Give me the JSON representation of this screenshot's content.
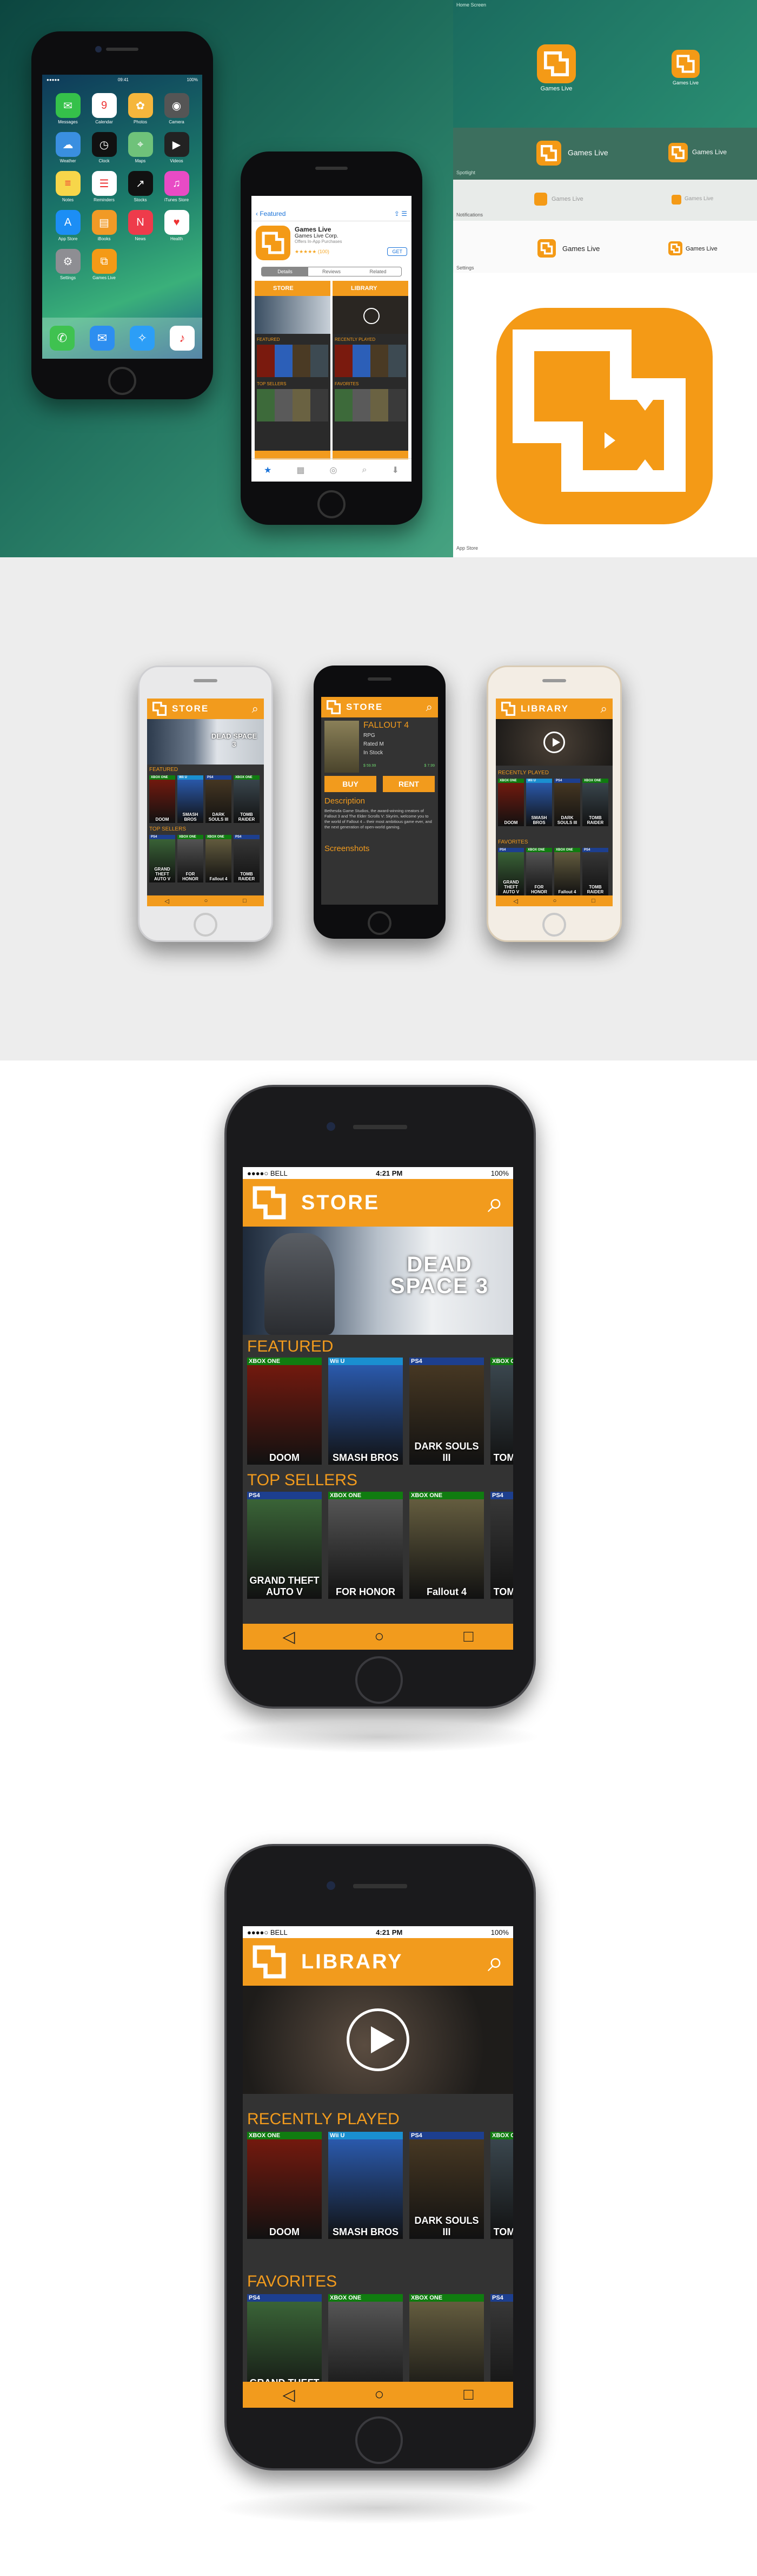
{
  "colors": {
    "accent": "#f29b1d",
    "appBg": "#333333",
    "iconOrange": "#f49a16"
  },
  "home": {
    "time": "09:41",
    "apps": [
      {
        "label": "Messages",
        "color": "#35c14a",
        "icon": "speech-bubble-icon"
      },
      {
        "label": "Calendar",
        "color": "#ffffff",
        "icon": "calendar-icon"
      },
      {
        "label": "Photos",
        "color": "#f5b63c",
        "icon": "photos-icon"
      },
      {
        "label": "Camera",
        "color": "#555555",
        "icon": "camera-icon"
      },
      {
        "label": "Weather",
        "color": "#3a8fe0",
        "icon": "weather-icon"
      },
      {
        "label": "Clock",
        "color": "#111111",
        "icon": "clock-icon"
      },
      {
        "label": "Maps",
        "color": "#6fc27a",
        "icon": "map-icon"
      },
      {
        "label": "Videos",
        "color": "#222222",
        "icon": "video-icon"
      },
      {
        "label": "Notes",
        "color": "#f7d64a",
        "icon": "notes-icon"
      },
      {
        "label": "Reminders",
        "color": "#ffffff",
        "icon": "reminders-icon"
      },
      {
        "label": "Stocks",
        "color": "#111111",
        "icon": "stocks-icon"
      },
      {
        "label": "iTunes Store",
        "color": "#e84bc5",
        "icon": "itunes-icon"
      },
      {
        "label": "App Store",
        "color": "#1c8ef5",
        "icon": "app-store-icon"
      },
      {
        "label": "iBooks",
        "color": "#f19a26",
        "icon": "books-icon"
      },
      {
        "label": "News",
        "color": "#ee3b4b",
        "icon": "news-icon"
      },
      {
        "label": "Health",
        "color": "#ffffff",
        "icon": "health-icon"
      },
      {
        "label": "Settings",
        "color": "#8e8e93",
        "icon": "settings-icon"
      },
      {
        "label": "Games Live",
        "color": "#f49a16",
        "icon": "games-live-icon"
      }
    ],
    "dock": [
      {
        "label": "Phone",
        "color": "#3fc250",
        "icon": "phone-icon"
      },
      {
        "label": "Mail",
        "color": "#2d8ef0",
        "icon": "mail-icon"
      },
      {
        "label": "Safari",
        "color": "#2c9ef7",
        "icon": "safari-icon"
      },
      {
        "label": "Music",
        "color": "#ffffff",
        "icon": "music-icon"
      }
    ]
  },
  "appstore": {
    "back": "Featured",
    "app_name": "Games Live",
    "company": "Games Live Corp.",
    "subtitle": "Offers In-App Purchases",
    "rating": "★★★★★ (100)",
    "get": "GET",
    "tabs": [
      "Details",
      "Reviews",
      "Related"
    ]
  },
  "iconsheet": {
    "top_label": "Home Screen",
    "app_name": "Games Live",
    "rows": [
      "Spotlight",
      "Notifications",
      "Settings"
    ],
    "bottom_label": "App Store"
  },
  "store": {
    "title": "STORE",
    "banner": "DEAD SPACE 3",
    "featured": "FEATURED",
    "top_sellers": "TOP SELLERS",
    "featured_games": [
      {
        "tag": "XBOX ONE",
        "name": "DOOM",
        "color": "#7a1a0e",
        "tagColor": "#107c10"
      },
      {
        "tag": "Wii U",
        "name": "SMASH BROS",
        "color": "#2c5fb8",
        "tagColor": "#1a8fd0"
      },
      {
        "tag": "PS4",
        "name": "DARK SOULS III",
        "color": "#4a3a24",
        "tagColor": "#1d3f8f"
      },
      {
        "tag": "XBOX ONE",
        "name": "TOMB RAIDER",
        "color": "#3d4a52",
        "tagColor": "#107c10"
      }
    ],
    "top_games": [
      {
        "tag": "PS4",
        "name": "GRAND THEFT AUTO V",
        "color": "#3d6a3a",
        "tagColor": "#1d3f8f"
      },
      {
        "tag": "XBOX ONE",
        "name": "FOR HONOR",
        "color": "#5a5a5a",
        "tagColor": "#107c10"
      },
      {
        "tag": "XBOX ONE",
        "name": "Fallout 4",
        "color": "#6a6242",
        "tagColor": "#107c10"
      },
      {
        "tag": "PS4",
        "name": "TOMB RAIDER",
        "color": "#3a3a3a",
        "tagColor": "#1d3f8f"
      }
    ]
  },
  "library": {
    "title": "LIBRARY",
    "recent": "RECENTLY PLAYED",
    "favorites": "FAVORITES"
  },
  "detail": {
    "title": "STORE",
    "game": "FALLOUT 4",
    "genre": "RPG",
    "rated": "Rated M",
    "stock": "In Stock",
    "buy": "BUY",
    "rent": "RENT",
    "buy_price": "$ 59.99",
    "rent_price": "$ 7.99",
    "description_title": "Description",
    "description": "Bethesda Game Studios, the award-winning creators of Fallout 3 and The Elder Scrolls V: Skyrim, welcome you to the world of Fallout 4 – their most ambitious game ever, and the next generation of open-world gaming.",
    "screenshots_title": "Screenshots"
  },
  "status": {
    "carrier": "●●●●○ BELL",
    "time": "4:21 PM",
    "battery": "100%"
  }
}
